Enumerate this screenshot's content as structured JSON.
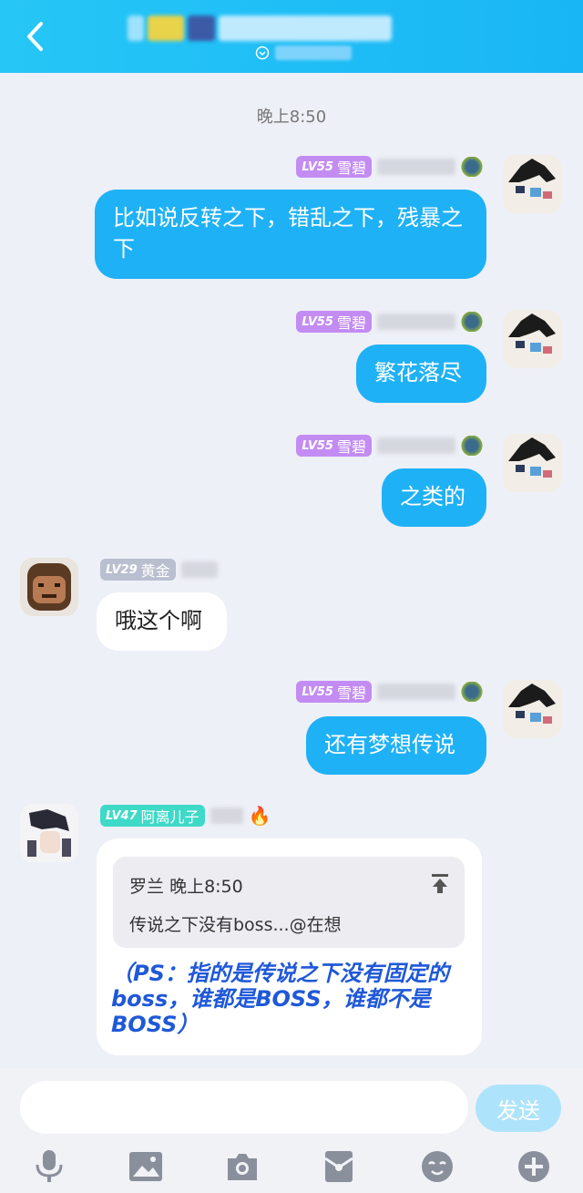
{
  "header": {
    "colors": {
      "bg": "#1fb6f5"
    },
    "icons": {
      "back": "chevron-left-icon",
      "subtitle": "status-icon"
    }
  },
  "chat": {
    "timestamp": "晚上8:50",
    "messages": [
      {
        "sender_level": "LV55",
        "sender_name": "雪碧",
        "direction": "out",
        "text": "比如说反转之下，错乱之下，残暴之下"
      },
      {
        "sender_level": "LV55",
        "sender_name": "雪碧",
        "direction": "out",
        "text": "繁花落尽"
      },
      {
        "sender_level": "LV55",
        "sender_name": "雪碧",
        "direction": "out",
        "text": "之类的"
      },
      {
        "sender_level": "LV29",
        "sender_name": "黄金",
        "direction": "in",
        "text": "哦这个啊"
      },
      {
        "sender_level": "LV55",
        "sender_name": "雪碧",
        "direction": "out",
        "text": "还有梦想传说"
      },
      {
        "sender_level": "LV47",
        "sender_name": "阿离儿子",
        "direction": "in",
        "quote": {
          "author": "罗兰",
          "time": "晚上8:50",
          "text": "传说之下没有boss...@在想"
        },
        "text": "（PS：指的是传说之下没有固定的boss，谁都是BOSS，谁都不是BOSS）"
      }
    ]
  },
  "composer": {
    "placeholder": "",
    "send_label": "发送",
    "tools": [
      "microphone-icon",
      "image-icon",
      "camera-icon",
      "red-packet-icon",
      "emoji-icon",
      "plus-icon"
    ]
  }
}
